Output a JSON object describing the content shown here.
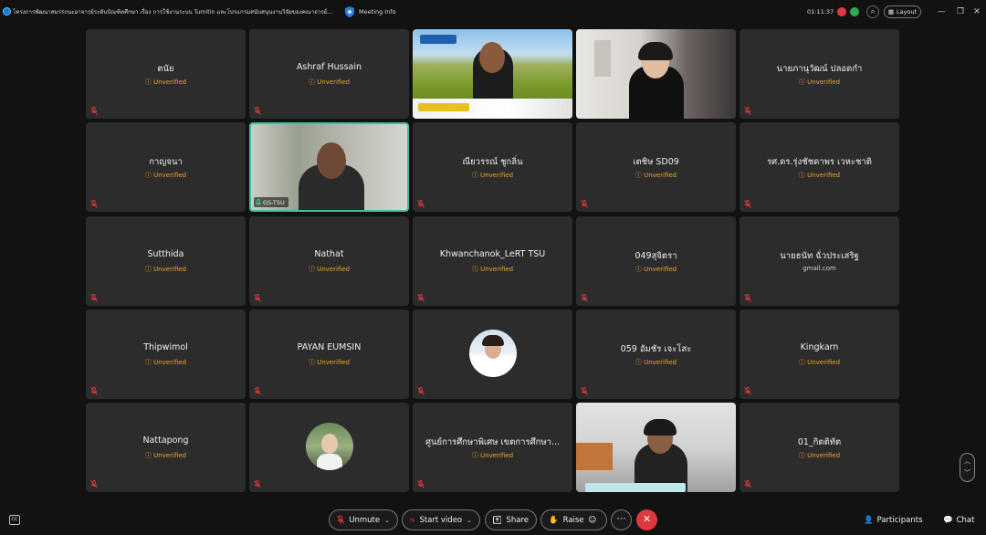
{
  "window": {
    "title": "โครงการพัฒนาสมรรถนะอาจารย์ระดับบัณฑิตศึกษา เรื่อง การใช้งานระบบ Turnitin และโปรแกรมสนับสนุนงานวิจัยของคณาจารย์...",
    "meeting_info": "Meeting Info",
    "timer": "01:11:37",
    "layout_label": "Layout"
  },
  "status_unverified": "Unverified",
  "tiles": [
    {
      "name": "ตนัย",
      "status": "Unverified"
    },
    {
      "name": "Ashraf Hussain",
      "status": "Unverified"
    },
    {
      "video": true
    },
    {
      "video": true
    },
    {
      "name": "นายภานุวัฒน์  ปลอดกำ",
      "status": "Unverified"
    },
    {
      "name": "กาญจนา",
      "status": "Unverified"
    },
    {
      "video": true,
      "label": "GS-TSU"
    },
    {
      "name": "ณียวรรณ์ ชูกลิ่น",
      "status": "Unverified"
    },
    {
      "name": "เตชิษ SD09",
      "status": "Unverified"
    },
    {
      "name": "รศ.ดร.รุ่งชัชดาพร เวหะชาติ",
      "status": "Unverified"
    },
    {
      "name": "Sutthida",
      "status": "Unverified"
    },
    {
      "name": "Nathat",
      "status": "Unverified"
    },
    {
      "name": "Khwanchanok_LeRT TSU",
      "status": "Unverified"
    },
    {
      "name": "049สุจิตรา",
      "status": "Unverified"
    },
    {
      "name": "นายธนัท ฉั่วประเสริฐ",
      "status": "gmail.com"
    },
    {
      "name": "Thipwimol",
      "status": "Unverified"
    },
    {
      "name": "PAYAN EUMSIN",
      "status": "Unverified"
    },
    {
      "avatar": true
    },
    {
      "name": "059 อัมชัร เจะโสะ",
      "status": "Unverified"
    },
    {
      "name": "Kingkarn",
      "status": "Unverified"
    },
    {
      "name": "Nattapong",
      "status": "Unverified"
    },
    {
      "avatar": true
    },
    {
      "name": "ศูนย์การศึกษาพิเศษ เขตการศึกษา...",
      "status": "Unverified"
    },
    {
      "video": true
    },
    {
      "name": "01_กิตติทัต",
      "status": "Unverified"
    }
  ],
  "controls": {
    "unmute": "Unmute",
    "start_video": "Start video",
    "share": "Share",
    "raise": "Raise",
    "participants": "Participants",
    "chat": "Chat"
  },
  "colors": {
    "tile_bg": "#2c2c2c",
    "unverified": "#f0a32a",
    "active_border": "#3fbfa0",
    "end_button": "#e0383e"
  }
}
